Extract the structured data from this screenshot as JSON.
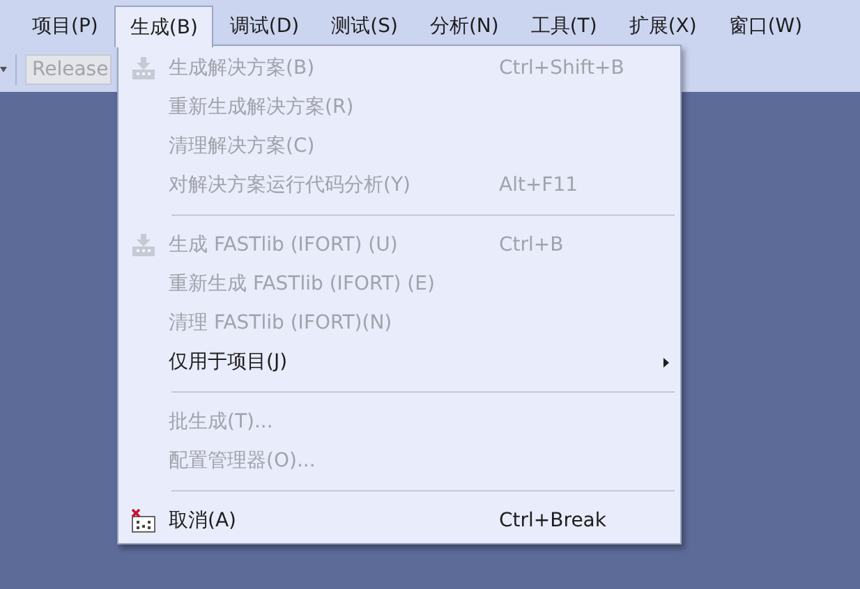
{
  "menubar": [
    {
      "label": "项目(P)",
      "selected": false
    },
    {
      "label": "生成(B)",
      "selected": true
    },
    {
      "label": "调试(D)",
      "selected": false
    },
    {
      "label": "测试(S)",
      "selected": false
    },
    {
      "label": "分析(N)",
      "selected": false
    },
    {
      "label": "工具(T)",
      "selected": false
    },
    {
      "label": "扩展(X)",
      "selected": false
    },
    {
      "label": "窗口(W)",
      "selected": false
    }
  ],
  "toolbar": {
    "configuration": {
      "value": "Release",
      "disabled": true
    }
  },
  "menu": [
    {
      "kind": "build",
      "label": "生成解决方案(B)",
      "shortcut": "Ctrl+Shift+B",
      "disabled": true
    },
    {
      "kind": "item",
      "label": "重新生成解决方案(R)",
      "disabled": true
    },
    {
      "kind": "item",
      "label": "清理解决方案(C)",
      "disabled": true
    },
    {
      "kind": "item",
      "label": "对解决方案运行代码分析(Y)",
      "shortcut": "Alt+F11",
      "disabled": true
    },
    {
      "kind": "separator"
    },
    {
      "kind": "build",
      "label": "生成 FASTlib (IFORT) (U)",
      "shortcut": "Ctrl+B",
      "disabled": true
    },
    {
      "kind": "item",
      "label": "重新生成 FASTlib (IFORT) (E)",
      "disabled": true
    },
    {
      "kind": "item",
      "label": "清理 FASTlib (IFORT)(N)",
      "disabled": true
    },
    {
      "kind": "submenu",
      "label": "仅用于项目(J)",
      "disabled": false
    },
    {
      "kind": "separator"
    },
    {
      "kind": "item",
      "label": "批生成(T)...",
      "disabled": true
    },
    {
      "kind": "item",
      "label": "配置管理器(O)...",
      "disabled": true
    },
    {
      "kind": "separator"
    },
    {
      "kind": "cancel",
      "label": "取消(A)",
      "shortcut": "Ctrl+Break",
      "disabled": false
    }
  ]
}
